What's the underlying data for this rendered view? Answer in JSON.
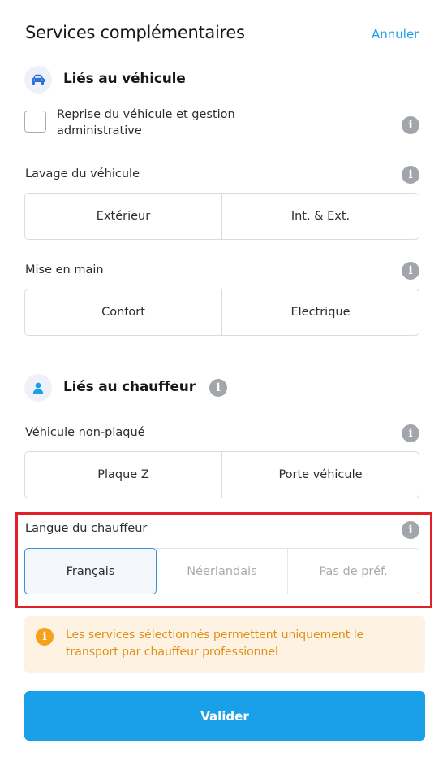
{
  "header": {
    "title": "Services complémentaires",
    "cancel_label": "Annuler"
  },
  "vehicle_section": {
    "title": "Liés au véhicule",
    "icon": "car-icon",
    "takeover": {
      "label": "Reprise du véhicule et gestion administrative",
      "checked": false
    },
    "washing": {
      "label": "Lavage du véhicule",
      "options": [
        "Extérieur",
        "Int. & Ext."
      ]
    },
    "handover": {
      "label": "Mise en main",
      "options": [
        "Confort",
        "Electrique"
      ]
    }
  },
  "driver_section": {
    "title": "Liés au chauffeur",
    "icon": "person-icon",
    "unplated": {
      "label": "Véhicule non-plaqué",
      "options": [
        "Plaque Z",
        "Porte véhicule"
      ]
    },
    "language": {
      "label": "Langue du chauffeur",
      "options": [
        "Français",
        "Néerlandais",
        "Pas de préf."
      ],
      "selected": "Français"
    }
  },
  "notice": {
    "text": "Les services sélectionnés permettent uniquement le transport par chauffeur professionnel"
  },
  "submit_label": "Valider",
  "colors": {
    "accent": "#1aa0e8",
    "highlight": "#e2202a",
    "notice_bg": "#fef3e3",
    "notice_text": "#e08d14"
  }
}
